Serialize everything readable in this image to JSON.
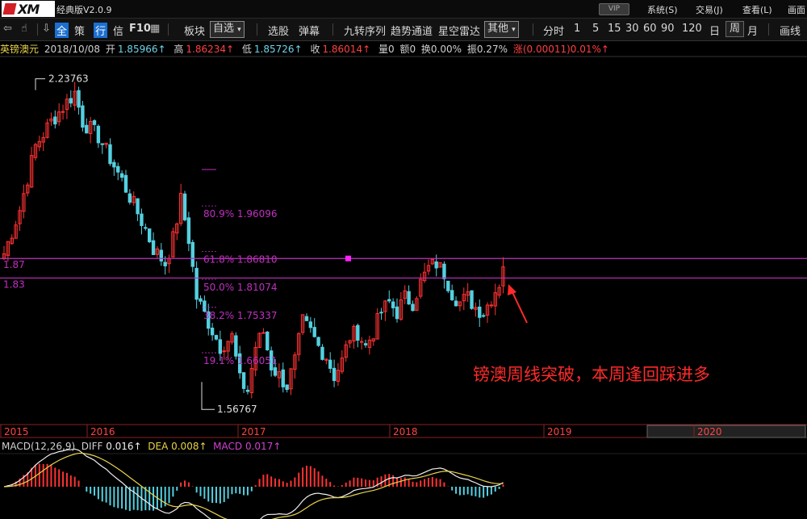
{
  "title_bar": {
    "logo_text": "XM",
    "app_title": "经典版V2.0.9",
    "vip_label": "VIP",
    "menus": [
      "系统(S)",
      "交易(J)",
      "查看(L)",
      "画面"
    ]
  },
  "toolbar": {
    "items": [
      "全",
      "策",
      "行",
      "信",
      "F10"
    ],
    "sector": "板块",
    "watchlist": "自选",
    "stock_picker": "选股",
    "popup": "弹幕",
    "nine_turn": "九转序列",
    "trend_channel": "趋势通道",
    "radar": "星空雷达",
    "other": "其他",
    "periods": [
      "分时",
      "1",
      "5",
      "15",
      "30",
      "60",
      "90",
      "120",
      "日",
      "周",
      "月"
    ],
    "active_period": "周",
    "draw": "画线"
  },
  "quote": {
    "name": "英镑澳元",
    "date": "2018/10/08",
    "open_label": "开",
    "open": "1.85966↑",
    "high_label": "高",
    "high": "1.86234↑",
    "low_label": "低",
    "low": "1.85726↑",
    "close_label": "收",
    "close": "1.86014↑",
    "volume": "量0",
    "amount": "额0",
    "turnover": "换0.00%",
    "amplitude": "振0.27%",
    "change": "涨(0.00011)0.01%↑"
  },
  "chart_data": {
    "type": "candlestick",
    "symbol": "英镑澳元",
    "period": "weekly",
    "year_labels": [
      "2015",
      "2016",
      "2017",
      "2018",
      "2019",
      "2020"
    ],
    "y_range": [
      1.54,
      2.28
    ],
    "max_label": "2.23763",
    "min_label": "1.56767",
    "resistance_lines": [
      {
        "label": "1.87",
        "value": 1.87
      },
      {
        "label": "1.83",
        "value": 1.83
      }
    ],
    "fibonacci": [
      {
        "label": "80.9%  1.96096",
        "value": 1.96096
      },
      {
        "label": "61.8%  1.86810",
        "value": 1.8681
      },
      {
        "label": "50.0%  1.81074",
        "value": 1.81074
      },
      {
        "label": "38.2%  1.75337",
        "value": 1.75337
      },
      {
        "label": "19.1%  1.66051",
        "value": 1.66051
      }
    ],
    "price_path": [
      [
        0,
        1.88
      ],
      [
        4,
        1.97
      ],
      [
        8,
        2.1
      ],
      [
        12,
        2.15
      ],
      [
        16,
        2.19
      ],
      [
        18,
        2.21
      ],
      [
        20,
        2.15
      ],
      [
        24,
        2.12
      ],
      [
        28,
        2.06
      ],
      [
        30,
        2.03
      ],
      [
        33,
        1.98
      ],
      [
        36,
        1.93
      ],
      [
        38,
        1.89
      ],
      [
        41,
        1.86
      ],
      [
        43,
        1.91
      ],
      [
        45,
        1.99
      ],
      [
        47,
        1.91
      ],
      [
        49,
        1.79
      ],
      [
        52,
        1.74
      ],
      [
        55,
        1.69
      ],
      [
        58,
        1.71
      ],
      [
        60,
        1.62
      ],
      [
        62,
        1.6
      ],
      [
        64,
        1.69
      ],
      [
        66,
        1.72
      ],
      [
        68,
        1.65
      ],
      [
        70,
        1.63
      ],
      [
        72,
        1.61
      ],
      [
        74,
        1.66
      ],
      [
        76,
        1.74
      ],
      [
        78,
        1.72
      ],
      [
        80,
        1.69
      ],
      [
        82,
        1.67
      ],
      [
        84,
        1.63
      ],
      [
        86,
        1.66
      ],
      [
        88,
        1.71
      ],
      [
        90,
        1.72
      ],
      [
        92,
        1.69
      ],
      [
        94,
        1.72
      ],
      [
        96,
        1.76
      ],
      [
        98,
        1.78
      ],
      [
        100,
        1.76
      ],
      [
        102,
        1.79
      ],
      [
        104,
        1.78
      ],
      [
        106,
        1.82
      ],
      [
        108,
        1.85
      ],
      [
        110,
        1.86
      ],
      [
        112,
        1.84
      ],
      [
        114,
        1.8
      ],
      [
        116,
        1.78
      ],
      [
        118,
        1.79
      ],
      [
        120,
        1.77
      ],
      [
        122,
        1.76
      ],
      [
        124,
        1.79
      ],
      [
        126,
        1.82
      ],
      [
        127,
        1.86
      ]
    ],
    "macd": {
      "params": "MACD(12,26,9)",
      "diff": "0.016↑",
      "dea": "0.008↑",
      "macd": "0.017↑"
    }
  },
  "annotation": "镑澳周线突破，本周逢回踩进多",
  "colors": {
    "background": "#000000",
    "up_candle": "#ff3232",
    "down_candle": "#54d0e0",
    "fib_line": "#c030c0",
    "resistance_line": "#c030c0",
    "annotation": "#ff2a2a",
    "year_axis": "#ff4444"
  }
}
